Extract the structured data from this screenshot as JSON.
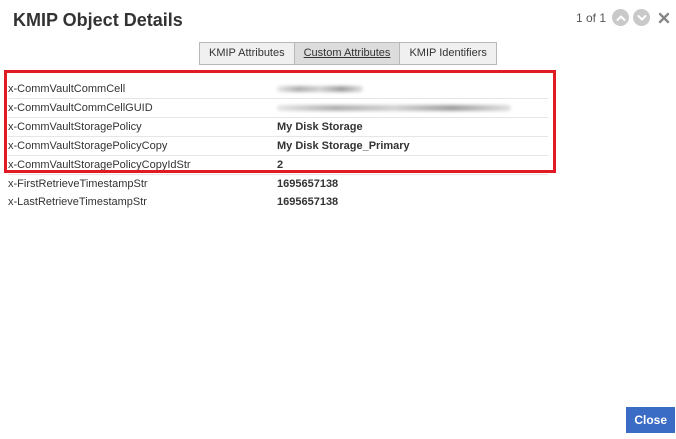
{
  "dialog": {
    "title": "KMIP Object Details",
    "pager_text": "1 of 1"
  },
  "tabs": [
    {
      "label": "KMIP Attributes",
      "active": false
    },
    {
      "label": "Custom Attributes",
      "active": true
    },
    {
      "label": "KMIP Identifiers",
      "active": false
    }
  ],
  "attributes": [
    {
      "name": "x-CommVaultCommCell",
      "value": "",
      "redacted": true
    },
    {
      "name": "x-CommVaultCommCellGUID",
      "value": "",
      "redacted": true
    },
    {
      "name": "x-CommVaultStoragePolicy",
      "value": "My Disk Storage"
    },
    {
      "name": "x-CommVaultStoragePolicyCopy",
      "value": "My Disk Storage_Primary"
    },
    {
      "name": "x-CommVaultStoragePolicyCopyIdStr",
      "value": "2"
    },
    {
      "name": "x-FirstRetrieveTimestampStr",
      "value": "1695657138"
    },
    {
      "name": "x-LastRetrieveTimestampStr",
      "value": "1695657138"
    }
  ],
  "footer": {
    "close_label": "Close"
  },
  "colors": {
    "highlight": "#e01b24",
    "primary_button": "#3b6cc5"
  },
  "icons": {
    "previous": "chevron-up-icon",
    "next": "chevron-down-icon",
    "close": "close-icon"
  }
}
